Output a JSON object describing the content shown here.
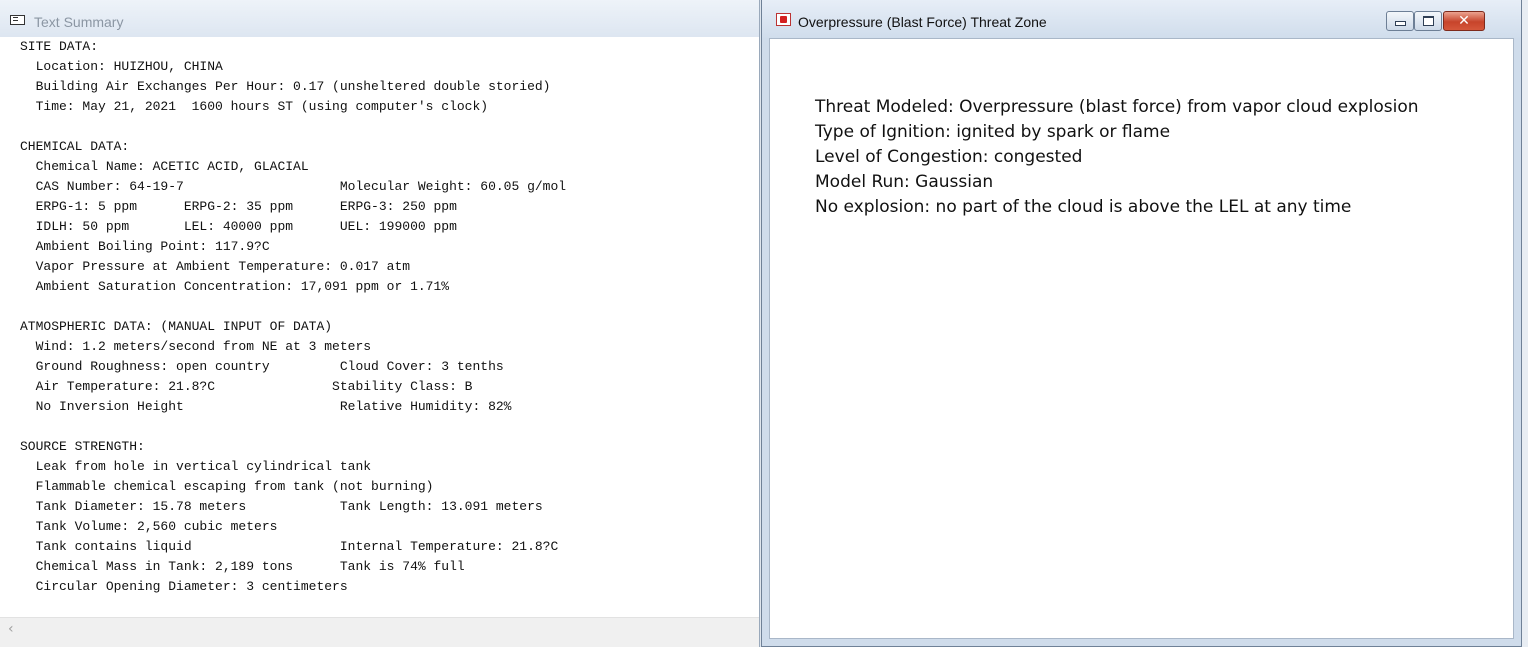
{
  "left_window": {
    "title": "Text Summary",
    "summary_lines": [
      "SITE DATA:",
      "  Location: HUIZHOU, CHINA",
      "  Building Air Exchanges Per Hour: 0.17 (unsheltered double storied)",
      "  Time: May 21, 2021  1600 hours ST (using computer's clock)",
      "",
      "CHEMICAL DATA:",
      "  Chemical Name: ACETIC ACID, GLACIAL",
      "  CAS Number: 64-19-7                    Molecular Weight: 60.05 g/mol",
      "  ERPG-1: 5 ppm      ERPG-2: 35 ppm      ERPG-3: 250 ppm",
      "  IDLH: 50 ppm       LEL: 40000 ppm      UEL: 199000 ppm",
      "  Ambient Boiling Point: 117.9?C",
      "  Vapor Pressure at Ambient Temperature: 0.017 atm",
      "  Ambient Saturation Concentration: 17,091 ppm or 1.71%",
      "",
      "ATMOSPHERIC DATA: (MANUAL INPUT OF DATA)",
      "  Wind: 1.2 meters/second from NE at 3 meters",
      "  Ground Roughness: open country         Cloud Cover: 3 tenths",
      "  Air Temperature: 21.8?C               Stability Class: B",
      "  No Inversion Height                    Relative Humidity: 82%",
      "",
      "SOURCE STRENGTH:",
      "  Leak from hole in vertical cylindrical tank",
      "  Flammable chemical escaping from tank (not burning)",
      "  Tank Diameter: 15.78 meters            Tank Length: 13.091 meters",
      "  Tank Volume: 2,560 cubic meters",
      "  Tank contains liquid                   Internal Temperature: 21.8?C",
      "  Chemical Mass in Tank: 2,189 tons      Tank is 74% full",
      "  Circular Opening Diameter: 3 centimeters"
    ],
    "scroll_left_glyph": "‹"
  },
  "right_window": {
    "title": "Overpressure (Blast Force) Threat Zone",
    "buttons": {
      "minimize_glyph": "",
      "maximize_glyph": "",
      "close_glyph": "✕"
    },
    "lines": [
      "Threat Modeled: Overpressure (blast force) from vapor cloud explosion",
      "Type of Ignition: ignited by spark or flame",
      "Level of Congestion: congested",
      "Model Run: Gaussian",
      "No explosion: no part of the cloud is above the LEL at any time"
    ]
  },
  "colors": {
    "titlebar": "#dde6f1",
    "close_button": "#c7442b",
    "window_border": "#6f8197"
  }
}
